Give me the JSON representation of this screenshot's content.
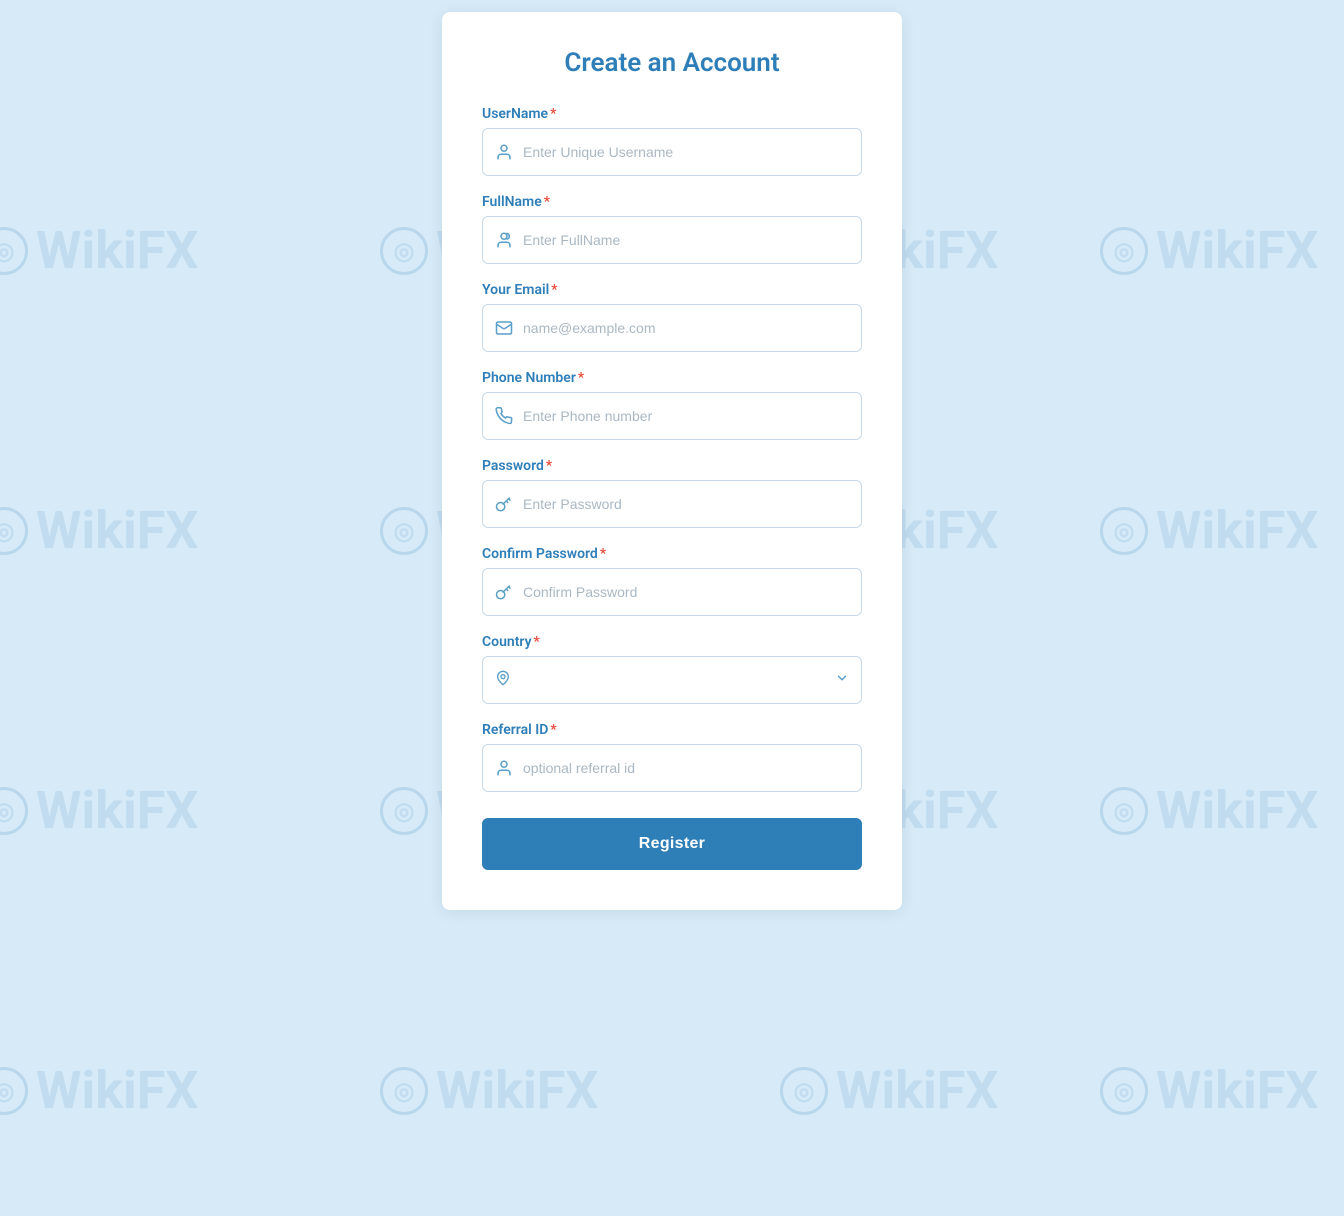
{
  "page": {
    "background_color": "#d6eaf8",
    "watermark_text": "WikiFX"
  },
  "card": {
    "title": "Create an Account"
  },
  "form": {
    "username": {
      "label": "UserName",
      "required": true,
      "placeholder": "Enter Unique Username"
    },
    "fullname": {
      "label": "FullName",
      "required": true,
      "placeholder": "Enter FullName"
    },
    "email": {
      "label": "Your Email",
      "required": true,
      "placeholder": "name@example.com"
    },
    "phone": {
      "label": "Phone Number",
      "required": true,
      "placeholder": "Enter Phone number"
    },
    "password": {
      "label": "Password",
      "required": true,
      "placeholder": "Enter Password"
    },
    "confirm_password": {
      "label": "Confirm Password",
      "required": true,
      "placeholder": "Confirm Password"
    },
    "country": {
      "label": "Country",
      "required": true,
      "placeholder": ""
    },
    "referral_id": {
      "label": "Referral ID",
      "required": true,
      "placeholder": "optional referral id"
    },
    "register_button": "Register"
  }
}
